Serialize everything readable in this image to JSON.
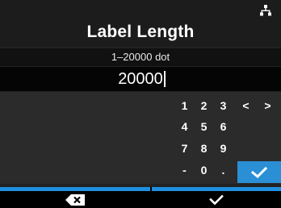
{
  "header": {
    "title": "Label Length",
    "status_icon": "network-icon"
  },
  "input": {
    "range_text": "1–20000 dot",
    "value": "20000"
  },
  "keypad": {
    "keys": {
      "k1": "1",
      "k2": "2",
      "k3": "3",
      "left": "<",
      "right": ">",
      "k4": "4",
      "k5": "5",
      "k6": "6",
      "k7": "7",
      "k8": "8",
      "k9": "9",
      "minus": "-",
      "k0": "0",
      "dot": "."
    },
    "enter_icon": "check-icon"
  },
  "footer": {
    "left_icon": "backspace-icon",
    "right_icon": "check-icon"
  },
  "colors": {
    "accent": "#2b8fd6",
    "footer_bar": "#1f8fe0"
  }
}
